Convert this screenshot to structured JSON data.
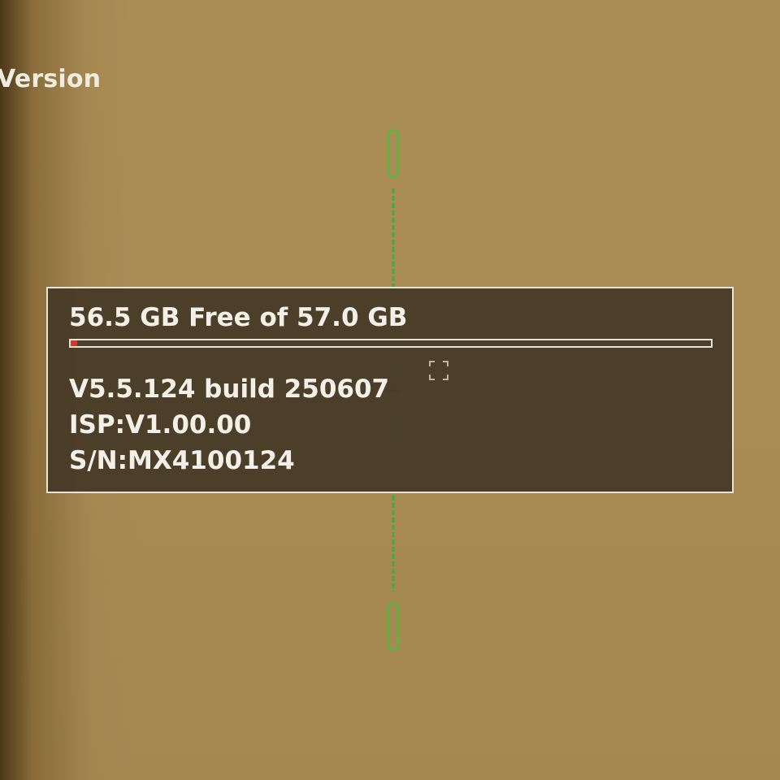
{
  "screen": {
    "title": "Version"
  },
  "storage": {
    "label": "56.5 GB Free of 57.0 GB",
    "used_fraction": 0.009,
    "bar_fill_color": "#d8352a"
  },
  "device_info": {
    "firmware": "V5.5.124 build 250607",
    "isp": "ISP:V1.00.00",
    "serial": "S/N:MX4100124"
  },
  "reticle": {
    "color": "#3fbf3a",
    "center_color": "#d8352a",
    "icons": [
      "crosshair-reticle-icon",
      "focus-bracket-icon"
    ]
  }
}
